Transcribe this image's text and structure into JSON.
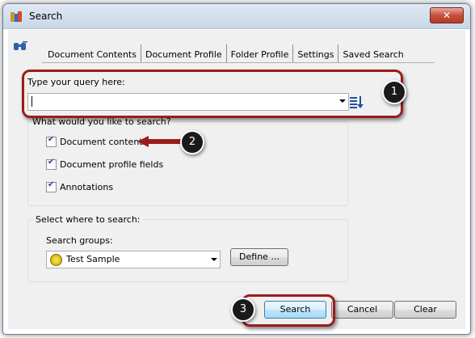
{
  "window": {
    "title": "Search",
    "close_glyph": "✕"
  },
  "tabs": [
    {
      "label": "Document Contents"
    },
    {
      "label": "Document Profile"
    },
    {
      "label": "Folder Profile"
    },
    {
      "label": "Settings"
    },
    {
      "label": "Saved Search"
    }
  ],
  "query": {
    "label": "Type your query here:",
    "value": ""
  },
  "search_what": {
    "title": "What would you like to search?",
    "options": [
      {
        "label": "Document contents",
        "checked": true
      },
      {
        "label": "Document profile fields",
        "checked": true
      },
      {
        "label": "Annotations",
        "checked": true
      }
    ]
  },
  "search_where": {
    "title": "Select where to search:",
    "groups_label": "Search groups:",
    "selected_group": "Test Sample",
    "define_label": "Define ..."
  },
  "buttons": {
    "search": "Search",
    "cancel": "Cancel",
    "clear": "Clear"
  },
  "callouts": {
    "one": "1",
    "two": "2",
    "three": "3"
  },
  "colors": {
    "highlight": "#9b1c1c",
    "badge": "#1a1a1a"
  },
  "icons": {
    "app": "app-icon",
    "binoculars": "binoculars-icon",
    "sort": "sort-order-icon",
    "group": "search-group-icon"
  }
}
